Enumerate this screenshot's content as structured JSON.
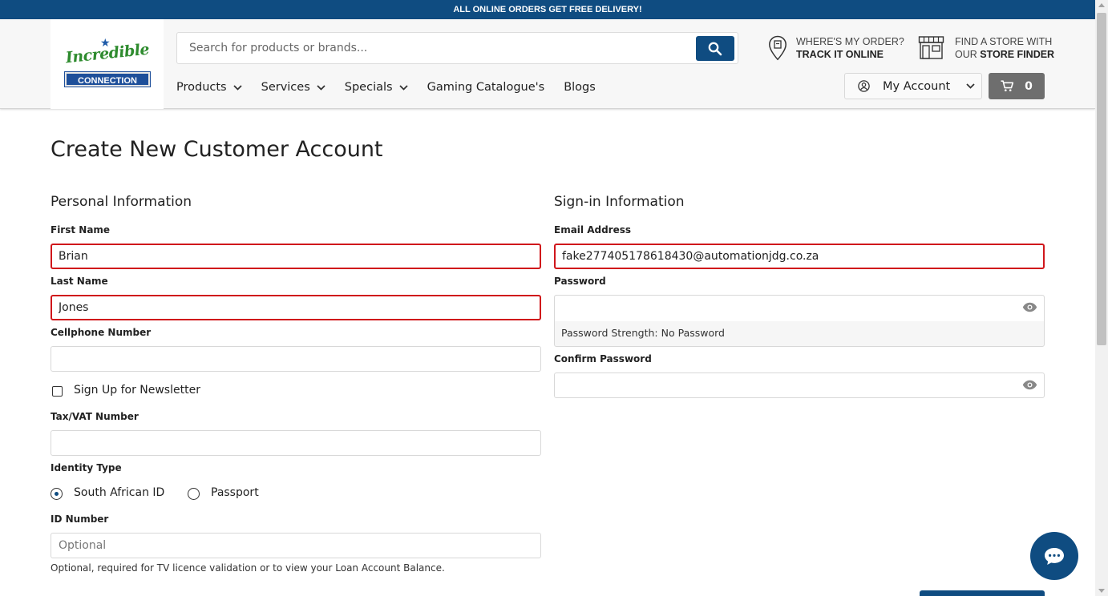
{
  "promo": {
    "text": "ALL ONLINE ORDERS GET FREE DELIVERY!"
  },
  "header": {
    "logo": {
      "word": "Incredible",
      "banner": "CONNECTION"
    },
    "search": {
      "placeholder": "Search for products or brands..."
    },
    "track": {
      "line1": "WHERE'S MY ORDER?",
      "line2": "TRACK IT ONLINE"
    },
    "store": {
      "line1": "FIND A STORE WITH",
      "line2_prefix": "OUR ",
      "line2_bold": "STORE FINDER"
    },
    "nav": [
      {
        "label": "Products",
        "dropdown": true
      },
      {
        "label": "Services",
        "dropdown": true
      },
      {
        "label": "Specials",
        "dropdown": true
      },
      {
        "label": "Gaming Catalogue's",
        "dropdown": false
      },
      {
        "label": "Blogs",
        "dropdown": false
      }
    ],
    "account": {
      "label": "My Account"
    },
    "cart": {
      "count": "0"
    }
  },
  "page": {
    "title": "Create New Customer Account",
    "personal": {
      "heading": "Personal Information",
      "first_name": {
        "label": "First Name",
        "value": "Brian"
      },
      "last_name": {
        "label": "Last Name",
        "value": "Jones"
      },
      "cellphone": {
        "label": "Cellphone Number",
        "value": ""
      },
      "newsletter": {
        "label": "Sign Up for Newsletter",
        "checked": false
      },
      "tax": {
        "label": "Tax/VAT Number",
        "value": ""
      },
      "identity": {
        "label": "Identity Type",
        "options": [
          {
            "label": "South African ID",
            "selected": true
          },
          {
            "label": "Passport",
            "selected": false
          }
        ]
      },
      "id_number": {
        "label": "ID Number",
        "placeholder": "Optional",
        "hint": "Optional, required for TV licence validation or to view your Loan Account Balance."
      }
    },
    "signin": {
      "heading": "Sign-in Information",
      "email": {
        "label": "Email Address",
        "value": "fake277405178618430@automationjdg.co.za"
      },
      "password": {
        "label": "Password",
        "value": "",
        "strength": "Password Strength: No Password"
      },
      "confirm": {
        "label": "Confirm Password",
        "value": ""
      }
    }
  },
  "colors": {
    "brand": "#0f4c81",
    "error": "#d0161b",
    "logo_green": "#2e8b2e"
  }
}
